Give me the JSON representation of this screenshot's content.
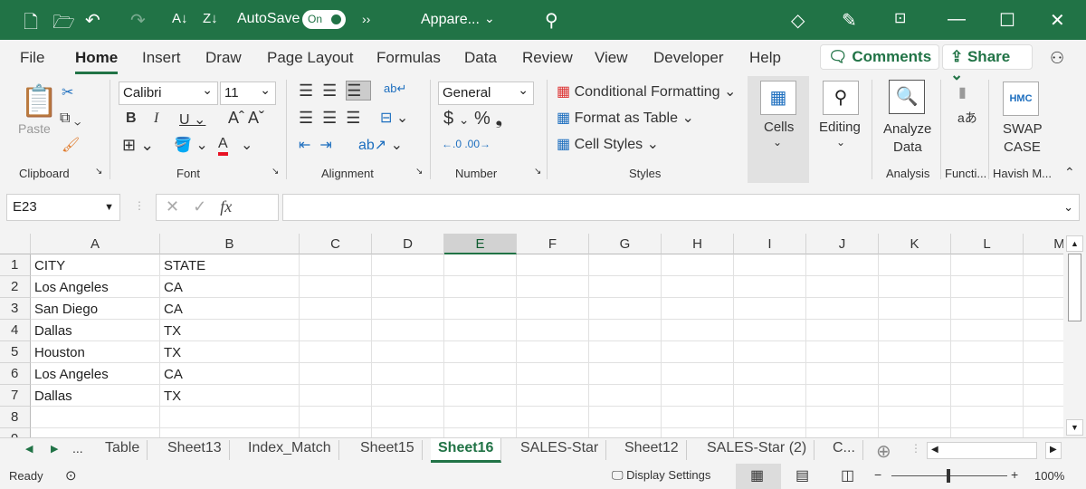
{
  "title_bar": {
    "autosave_label": "AutoSave",
    "autosave_state": "On",
    "file_name": "Appare...",
    "icons": [
      "new-file-icon",
      "open-folder-icon",
      "undo-icon",
      "redo-icon",
      "sort-ascending-icon",
      "sort-descending-icon",
      "more-icon",
      "search-icon",
      "diamond-icon",
      "pen-icon",
      "restore-ribbon-icon",
      "minimize-icon",
      "maximize-icon",
      "close-icon"
    ]
  },
  "menu": {
    "tabs": [
      "File",
      "Home",
      "Insert",
      "Draw",
      "Page Layout",
      "Formulas",
      "Data",
      "Review",
      "View",
      "Developer",
      "Help"
    ],
    "active": "Home",
    "comments": "Comments",
    "share": "Share"
  },
  "ribbon": {
    "clipboard": {
      "label": "Clipboard",
      "paste": "Paste"
    },
    "font": {
      "label": "Font",
      "font_name": "Calibri",
      "font_size": "11",
      "font_color": "#e81123"
    },
    "alignment": {
      "label": "Alignment"
    },
    "number": {
      "label": "Number",
      "format": "General"
    },
    "styles": {
      "label": "Styles",
      "conditional": "Conditional Formatting",
      "format_table": "Format as Table",
      "cell_styles": "Cell Styles"
    },
    "cells": {
      "label": "Cells"
    },
    "editing": {
      "label": "Editing"
    },
    "analysis": {
      "label": "Analysis",
      "analyze": "Analyze",
      "data": "Data"
    },
    "functions": {
      "label": "Functi..."
    },
    "havish": {
      "label": "Havish M...",
      "swap": "SWAP",
      "case": "CASE",
      "logo": "HMC"
    }
  },
  "formula_bar": {
    "name_box": "E23",
    "fx": "fx",
    "value": ""
  },
  "grid": {
    "columns": [
      "A",
      "B",
      "C",
      "D",
      "E",
      "F",
      "G",
      "H",
      "I",
      "J",
      "K",
      "L",
      "M"
    ],
    "selected_column": "E",
    "rows": [
      [
        "CITY",
        "STATE"
      ],
      [
        "Los Angeles",
        "CA"
      ],
      [
        "San Diego",
        "CA"
      ],
      [
        "Dallas",
        "TX"
      ],
      [
        "Houston",
        "TX"
      ],
      [
        "Los Angeles",
        "CA"
      ],
      [
        "Dallas",
        "TX"
      ],
      [
        "",
        ""
      ],
      [
        "",
        ""
      ]
    ]
  },
  "sheet_tabs": {
    "items": [
      "Table",
      "Sheet13",
      "Index_Match",
      "Sheet15",
      "Sheet16",
      "SALES-Star",
      "Sheet12",
      "SALES-Star (2)",
      "C..."
    ],
    "active": "Sheet16"
  },
  "status_bar": {
    "ready": "Ready",
    "display_settings": "Display Settings",
    "zoom": "100%",
    "zoom_minus": "−",
    "zoom_plus": "+"
  },
  "colors": {
    "accent": "#217346"
  }
}
